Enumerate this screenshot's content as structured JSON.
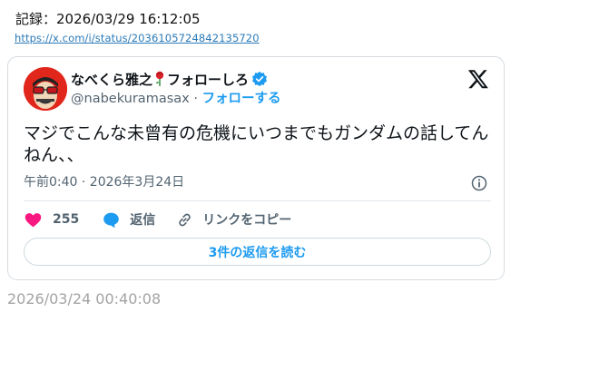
{
  "record": {
    "label": "記録：2026/03/29 16:12:05",
    "url": "https://x.com/i/status/2036105724842135720"
  },
  "tweet": {
    "display_name": "なべくら雅之",
    "display_name_suffix": "フォローしろ",
    "verified": true,
    "handle": "@nabekuramasax",
    "separator": "·",
    "follow_label": "フォローする",
    "text": "マジでこんな未曾有の危機にいつまでもガンダムの話してんねん、、",
    "timestamp": "午前0:40 · 2026年3月24日",
    "like_count": "255",
    "reply_label": "返信",
    "copy_link_label": "リンクをコピー",
    "read_replies_label": "3件の返信を読む"
  },
  "archived_time": "2026/03/24 00:40:08",
  "icons": {
    "brand": "x-logo-icon",
    "verified": "verified-badge-icon",
    "rose": "rose-emoji-icon",
    "info": "info-icon",
    "like": "heart-icon",
    "reply": "speech-bubble-icon",
    "copy": "link-icon"
  },
  "colors": {
    "accent": "#1d9bf0",
    "like": "#f91880",
    "avatar_bg": "#e1261c",
    "link": "#2a7ab8",
    "muted_text": "#536471",
    "archived_text": "#a3a3a3"
  }
}
